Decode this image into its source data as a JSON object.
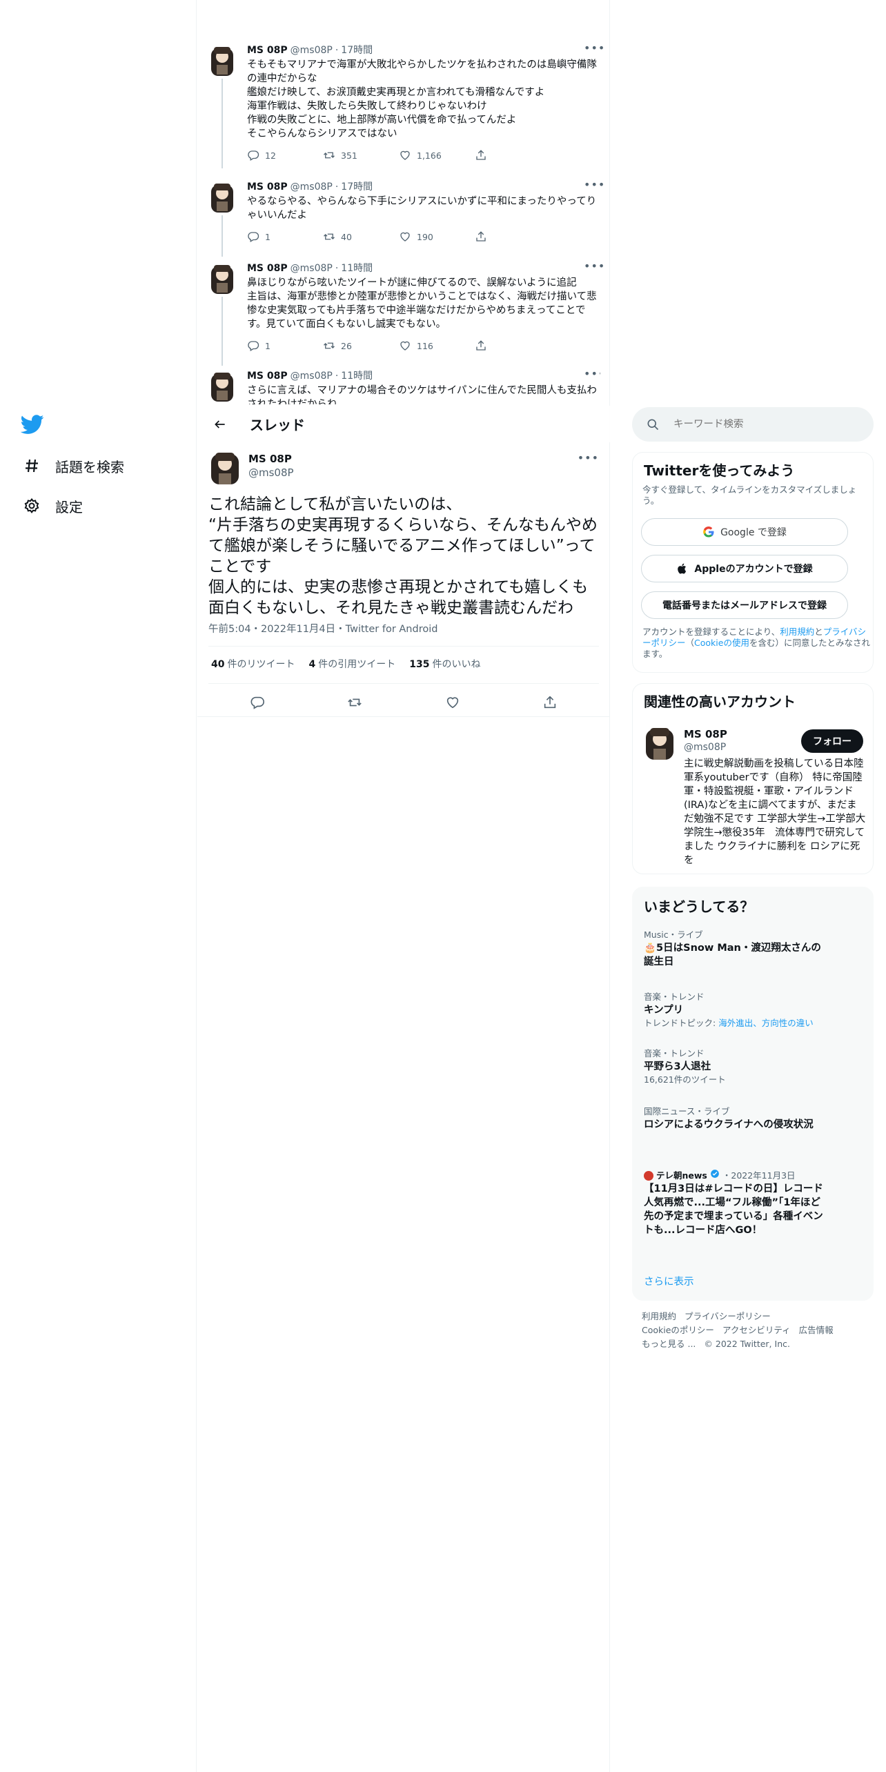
{
  "nav": {
    "items": [
      {
        "label": "話題を検索",
        "icon": "hashtag-icon"
      },
      {
        "label": "設定",
        "icon": "gear-icon"
      }
    ]
  },
  "replies": [
    {
      "name": "MS 08P",
      "handle": "@ms08P",
      "time": "17時間",
      "text": "そもそもマリアナで海軍が大敗北やらかしたツケを払わされたのは島嶼守備隊の連中だからな\n艦娘だけ映して、お涙頂戴史実再現とか言われても滑稽なんですよ\n海軍作戦は、失敗したら失敗して終わりじゃないわけ\n作戦の失敗ごとに、地上部隊が高い代償を命で払ってんだよ\nそこやらんならシリアスではない",
      "replies": "12",
      "retweets": "351",
      "likes": "1,166"
    },
    {
      "name": "MS 08P",
      "handle": "@ms08P",
      "time": "17時間",
      "text": "やるならやる、やらんなら下手にシリアスにいかずに平和にまったりやってりゃいいんだよ",
      "replies": "1",
      "retweets": "40",
      "likes": "190"
    },
    {
      "name": "MS 08P",
      "handle": "@ms08P",
      "time": "11時間",
      "text": "鼻ほじりながら呟いたツイートが謎に伸びてるので、誤解ないように追記\n主旨は、海軍が悲惨とか陸軍が悲惨とかいうことではなく、海戦だけ描いて悲惨な史実気取っても片手落ちで中途半端なだけだからやめちまえってことです。見ていて面白くもないし誠実でもない。",
      "replies": "1",
      "retweets": "26",
      "likes": "116"
    },
    {
      "name": "MS 08P",
      "handle": "@ms08P",
      "time": "11時間",
      "text": "さらに言えば、マリアナの場合そのツケはサイパンに住んでた民間人も支払わされたわけだからね"
    }
  ],
  "header": {
    "title": "スレッド"
  },
  "main_tweet": {
    "name": "MS 08P",
    "handle": "@ms08P",
    "text": "これ結論として私が言いたいのは、\n“片手落ちの史実再現するくらいなら、そんなもんやめて艦娘が楽しそうに騒いでるアニメ作ってほしい”ってことです\n個人的には、史実の悲惨さ再現とかされても嬉しくも面白くもないし、それ見たきゃ戦史叢書読むんだわ",
    "meta": "午前5:04・2022年11月4日・Twitter for Android",
    "retweets": "40",
    "retweets_label": "件のリツイート",
    "quotes": "4",
    "quotes_label": "件の引用ツイート",
    "likes": "135",
    "likes_label": "件のいいね"
  },
  "search": {
    "placeholder": "キーワード検索"
  },
  "signup": {
    "title": "Twitterを使ってみよう",
    "subtitle": "今すぐ登録して、タイムラインをカスタマイズしましょう。",
    "google": "Google で登録",
    "apple": "Appleのアカウントで登録",
    "phone": "電話番号またはメールアドレスで登録",
    "legal_prefix": "アカウントを登録することにより、",
    "legal_terms": "利用規約",
    "legal_and": "と",
    "legal_privacy": "プライバシーポリシー",
    "legal_open": "（",
    "legal_cookie": "Cookieの使用",
    "legal_suffix": "を含む）に同意したとみなされます。"
  },
  "related": {
    "title": "関連性の高いアカウント",
    "name": "MS 08P",
    "handle": "@ms08P",
    "follow": "フォロー",
    "bio": "主に戦史解説動画を投稿している日本陸軍系youtuberです（自称） 特に帝国陸軍・特設監視艇・軍歌・アイルランド(IRA)などを主に調べてますが、まだまだ勉強不足です 工学部大学生→工学部大学院生→懲役35年　流体専門で研究してました ウクライナに勝利を ロシアに死を"
  },
  "trends": {
    "title": "いまどうしてる？",
    "items": [
      {
        "cat": "Music・ライブ",
        "title": "🎂5日はSnow Man・渡辺翔太さんの誕生日"
      },
      {
        "cat": "音楽・トレンド",
        "title": "キンプリ",
        "extra_prefix": "トレンドトピック: ",
        "extra_link": "海外進出、方向性の違い"
      },
      {
        "cat": "音楽・トレンド",
        "title": "平野ら3人退社",
        "extra": "16,621件のツイート"
      },
      {
        "cat": "国際ニュース・ライブ",
        "title": "ロシアによるウクライナへの侵攻状況"
      },
      {
        "source": "テレ朝news",
        "date": "・2022年11月3日",
        "title": "【11月3日は#レコードの日】レコード人気再燃で...工場“フル稼働”「1年ほど先の予定まで埋まっている」各種イベントも...レコード店へGO！"
      }
    ],
    "show_more": "さらに表示"
  },
  "footer": {
    "links": [
      "利用規約",
      "プライバシーポリシー",
      "Cookieのポリシー",
      "アクセシビリティ",
      "広告情報",
      "もっと見る ...",
      "© 2022 Twitter, Inc."
    ]
  },
  "colors": {
    "accent": "#1d9bf0",
    "text": "#0f1419",
    "muted": "#536471",
    "border": "#eff3f4"
  }
}
